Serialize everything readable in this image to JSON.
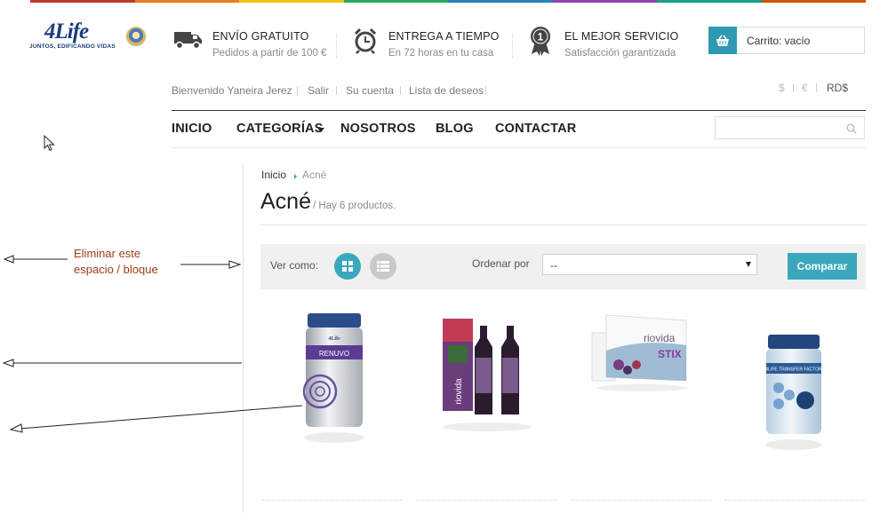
{
  "brand": {
    "logo_text": "4Life",
    "tagline": "JUNTOS, EDIFICANDO VIDAS",
    "top_colors": [
      "#c0392b",
      "#e67e22",
      "#f1c40f",
      "#27ae60",
      "#2980b9",
      "#8e44ad",
      "#16a085",
      "#d35400"
    ]
  },
  "features": [
    {
      "icon": "truck-icon",
      "title": "ENVÍO GRATUITO",
      "subtitle": "Pedidos a partir de 100 €"
    },
    {
      "icon": "alarm-clock-icon",
      "title": "ENTREGA A TIEMPO",
      "subtitle": "En 72 horas en tu casa"
    },
    {
      "icon": "medal-icon",
      "title": "EL MEJOR SERVICIO",
      "subtitle": "Satisfacción garantizada",
      "badge": "1"
    }
  ],
  "cart": {
    "label": "Carrito: vacío",
    "icon": "basket-icon"
  },
  "user_links": [
    "Bienvenido Yaneira Jerez",
    "Salir",
    "Su cuenta",
    "Lista de deseos"
  ],
  "currencies": [
    "$",
    "€",
    "RD$"
  ],
  "nav": [
    "INICIO",
    "CATEGORÍAS",
    "NOSOTROS",
    "BLOG",
    "CONTACTAR"
  ],
  "search": {
    "placeholder": ""
  },
  "breadcrumb": {
    "home": "Inicio",
    "current": "Acné"
  },
  "page": {
    "title": "Acné",
    "count": "/ Hay 6 productos."
  },
  "toolbar": {
    "view_label": "Ver como:",
    "sort_label": "Ordenar por",
    "sort_value": "--",
    "compare_label": "Comparar"
  },
  "products": [
    {
      "image": "renuvo-jar",
      "label": "RENUVO"
    },
    {
      "image": "riovida-bottles",
      "label": "riovida"
    },
    {
      "image": "riovida-stix-box",
      "label": "riovida"
    },
    {
      "image": "transfer-factor-jar",
      "label": "4LIFE TRANSFER FACTOR"
    }
  ],
  "annotation": {
    "note_line1": "Eliminar este",
    "note_line2": "espacio / bloque"
  },
  "colors": {
    "accent": "#3aa7bd",
    "annotation": "#a03b1a"
  }
}
